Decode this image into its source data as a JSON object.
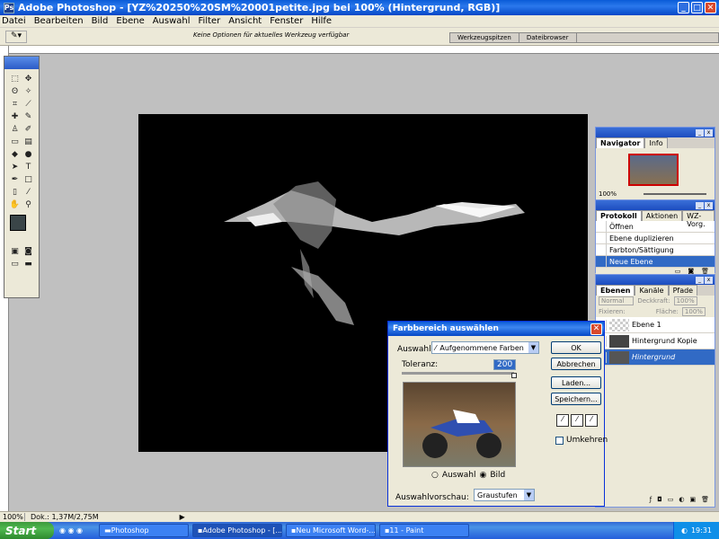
{
  "window": {
    "title": "Adobe Photoshop - [YZ%20250%20SM%20001petite.jpg bei 100% (Hintergrund, RGB)]"
  },
  "menu": [
    "Datei",
    "Bearbeiten",
    "Bild",
    "Ebene",
    "Auswahl",
    "Filter",
    "Ansicht",
    "Fenster",
    "Hilfe"
  ],
  "options": {
    "hint": "Keine Optionen für aktuelles Werkzeug verfügbar",
    "tabs": [
      "Werkzeugspitzen",
      "Dateibrowser"
    ]
  },
  "navigator": {
    "tabs": [
      "Navigator",
      "Info"
    ],
    "zoom": "100%"
  },
  "history": {
    "tabs": [
      "Protokoll",
      "Aktionen",
      "WZ-Vorg."
    ],
    "items": [
      "Öffnen",
      "Ebene duplizieren",
      "Farbton/Sättigung",
      "Neue Ebene"
    ]
  },
  "layers": {
    "tabs": [
      "Ebenen",
      "Kanäle",
      "Pfade"
    ],
    "mode": "Normal",
    "opacity_label": "Deckkraft:",
    "opacity": "100%",
    "fill_label": "Fläche:",
    "fill": "100%",
    "lock_label": "Fixieren:",
    "items": [
      "Ebene 1",
      "Hintergrund Kopie",
      "Hintergrund"
    ]
  },
  "dialog": {
    "title": "Farbbereich auswählen",
    "select_label": "Auswahl:",
    "select_value": "Aufgenommene Farben",
    "tolerance_label": "Toleranz:",
    "tolerance": "200",
    "buttons": [
      "OK",
      "Abbrechen",
      "Laden...",
      "Speichern..."
    ],
    "invert_label": "Umkehren",
    "radio_selection": "Auswahl",
    "radio_image": "Bild",
    "preview_label": "Auswahlvorschau:",
    "preview_value": "Graustufen"
  },
  "status": {
    "zoom": "100%",
    "doc": "Dok.: 1,37M/2,75M"
  },
  "taskbar": {
    "start": "Start",
    "tasks": [
      "Photoshop",
      "Adobe Photoshop - [...",
      "Neu Microsoft Word-...",
      "11 - Paint"
    ],
    "time": "19:31"
  }
}
